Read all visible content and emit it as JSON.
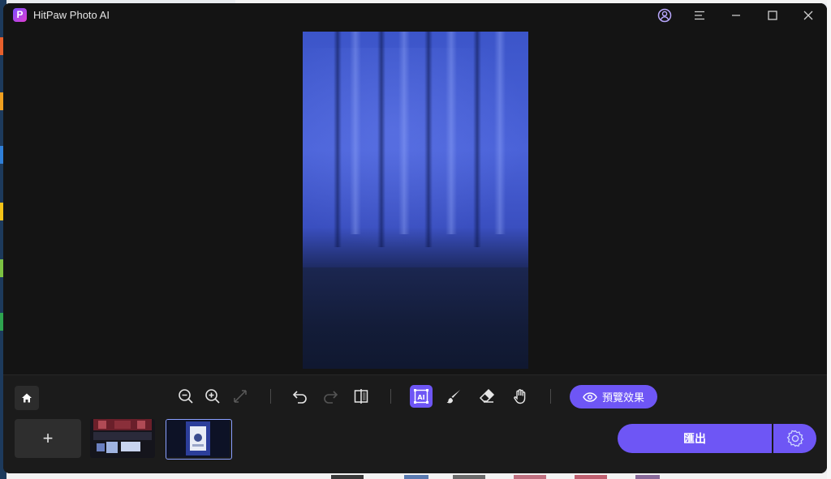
{
  "app": {
    "title": "HitPaw Photo AI",
    "logo_letter": "P",
    "accent_color": "#6e56f5"
  },
  "titlebar": {
    "icons": [
      "account-icon",
      "menu-icon",
      "minimize-icon",
      "maximize-icon",
      "close-icon"
    ]
  },
  "toolbar": {
    "icons": [
      "home-icon",
      "zoom-out-icon",
      "zoom-in-icon",
      "fit-screen-icon",
      "undo-icon",
      "redo-icon",
      "compare-split-icon",
      "ai-select-icon",
      "brush-icon",
      "eraser-icon",
      "hand-icon"
    ],
    "active_tool": "ai-select-icon",
    "preview_label": "預覽效果"
  },
  "filmstrip": {
    "add_label": "+",
    "thumbnails": [
      "thumbnail-1",
      "thumbnail-2"
    ],
    "selected_index": 1
  },
  "export": {
    "label": "匯出"
  }
}
